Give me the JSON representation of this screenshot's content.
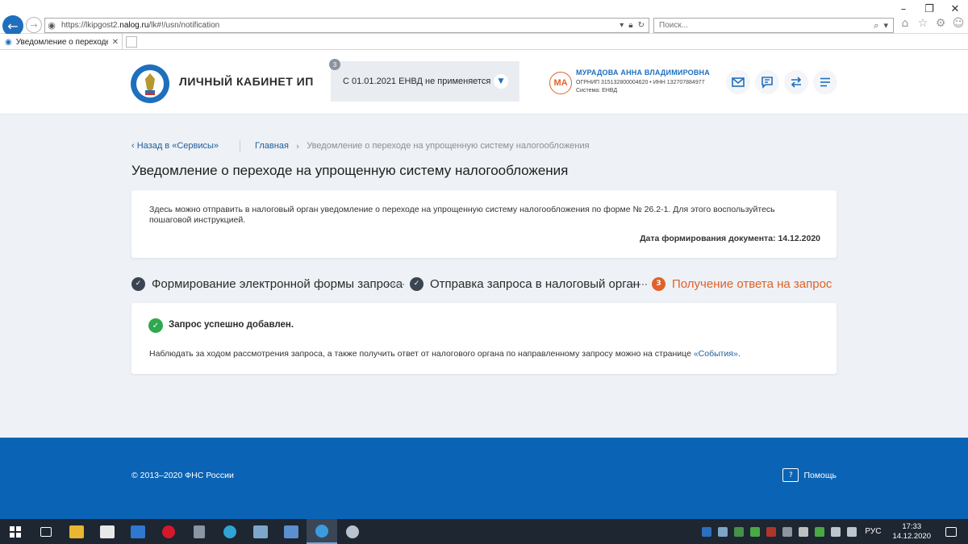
{
  "browser": {
    "url_prefix": "https://lkipgost2.",
    "url_domain": "nalog.ru",
    "url_path": "/lk#!/usn/notification",
    "search_placeholder": "Поиск...",
    "tab_title": "Уведомление о переходе ...",
    "icons": [
      "back-arrow-icon",
      "forward-arrow-icon",
      "site-icon",
      "lock-icon",
      "refresh-icon",
      "search-icon",
      "home-icon",
      "star-icon",
      "gear-icon",
      "smiley-icon"
    ]
  },
  "header": {
    "brand": "ЛИЧНЫЙ КАБИНЕТ ИП",
    "regime_badge": "3",
    "regime_label": "С 01.01.2021 ЕНВД не применяется",
    "avatar_initials": "МА",
    "user_name": "МУРАДОВА АННА ВЛАДИМИРОВНА",
    "user_ids": "ОГРНИП 315132800004620  •  ИНН 132707884977",
    "user_system": "Система: ЕНВД"
  },
  "breadcrumbs": {
    "back": "Назад в «Сервисы»",
    "home": "Главная",
    "current": "Уведомление о переходе на упрощенную систему налогообложения"
  },
  "page": {
    "title": "Уведомление о переходе на упрощенную систему налогообложения",
    "info_text": "Здесь можно отправить в налоговый орган уведомление о переходе на упрощенную систему налогообложения по форме № 26.2-1. Для этого воспользуйтесь пошаговой инструкцией.",
    "doc_date": "Дата формирования документа: 14.12.2020"
  },
  "steps": [
    {
      "label": "Формирование электронной формы запроса",
      "status": "done"
    },
    {
      "label": "Отправка запроса в налоговый орган",
      "status": "done"
    },
    {
      "label": "Получение ответа на запрос",
      "status": "current",
      "number": "3"
    }
  ],
  "result": {
    "title": "Запрос успешно добавлен.",
    "text_before": "Наблюдать за ходом рассмотрения запроса, а также получить ответ от налогового органа по направленному запросу можно на странице ",
    "link": "«События»",
    "text_after": "."
  },
  "footer": {
    "copyright": "© 2013–2020 ФНС России",
    "help": "Помощь"
  },
  "taskbar": {
    "lang": "РУС",
    "time": "17:33",
    "date": "14.12.2020"
  },
  "colors": {
    "accent": "#1e6fbd",
    "orange": "#e0622a",
    "success": "#2fa84f",
    "footer": "#0b63b5"
  }
}
